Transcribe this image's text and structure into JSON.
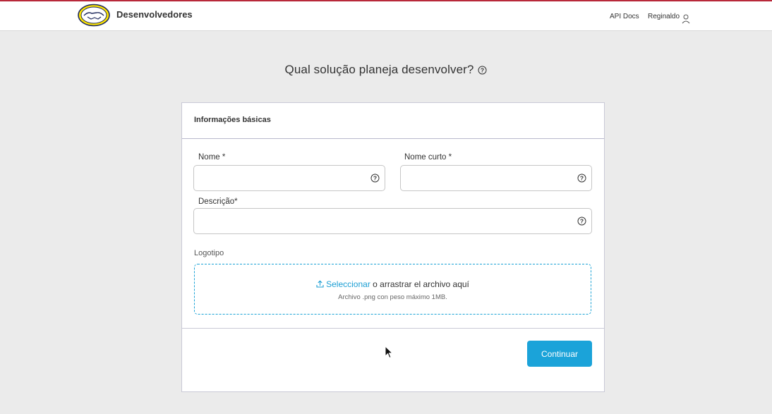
{
  "header": {
    "brand": "Desenvolvedores",
    "nav": {
      "api_docs": "API Docs",
      "user": "Reginaldo"
    },
    "accent_color": "#b8283a",
    "logo_color": "#ffe600"
  },
  "page": {
    "title": "Qual solução planeja desenvolver?"
  },
  "card": {
    "section_title": "Informações básicas",
    "fields": {
      "nome": {
        "label": "Nome *",
        "value": ""
      },
      "nome_curto": {
        "label": "Nome curto *",
        "value": ""
      },
      "descricao": {
        "label": "Descrição*",
        "value": ""
      }
    },
    "logo": {
      "label": "Logotipo",
      "select_link": "Seleccionar",
      "drop_text": " o arrastrar el archivo aquí",
      "hint": "Archivo .png con peso máximo 1MB."
    },
    "continue_label": "Continuar",
    "primary_color": "#1ba3d9"
  },
  "icons": {
    "help": "help-circle-icon",
    "upload": "upload-icon",
    "user": "user-icon",
    "logo": "handshake-logo"
  }
}
